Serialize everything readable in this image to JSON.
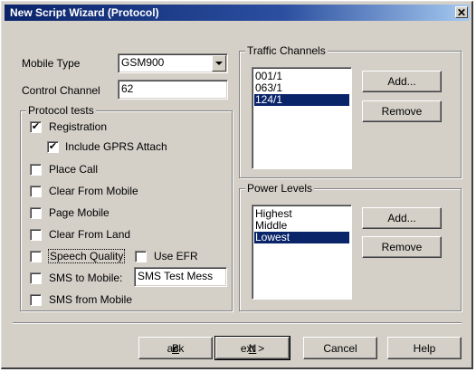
{
  "window": {
    "title": "New Script Wizard (Protocol)",
    "close_glyph": "✕"
  },
  "form": {
    "mobile_type_label": "Mobile Type",
    "mobile_type_value": "GSM900",
    "control_channel_label": "Control Channel",
    "control_channel_value": "62"
  },
  "protocol_tests": {
    "title": "Protocol tests",
    "registration": {
      "label": "Registration",
      "checked": true
    },
    "gprs_attach": {
      "label": "Include GPRS Attach",
      "checked": true
    },
    "place_call": {
      "label": "Place Call",
      "checked": false
    },
    "clear_from_mobile": {
      "label": "Clear From Mobile",
      "checked": false
    },
    "page_mobile": {
      "label": "Page Mobile",
      "checked": false
    },
    "clear_from_land": {
      "label": "Clear From Land",
      "checked": false
    },
    "speech_quality": {
      "label": "Speech Quality",
      "checked": false
    },
    "use_efr": {
      "label": "Use EFR",
      "checked": false
    },
    "sms_to_mobile": {
      "label": "SMS to Mobile:",
      "checked": false,
      "text_value": "SMS Test Mess"
    },
    "sms_from_mobile": {
      "label": "SMS from Mobile",
      "checked": false
    }
  },
  "traffic_channels": {
    "title": "Traffic Channels",
    "items": [
      "001/1",
      "063/1",
      "124/1"
    ],
    "selected_index": 2,
    "add_label": "Add...",
    "remove_label": "Remove"
  },
  "power_levels": {
    "title": "Power Levels",
    "items": [
      "Highest",
      "Middle",
      "Lowest"
    ],
    "selected_index": 2,
    "add_label": "Add...",
    "remove_label": "Remove"
  },
  "buttons": {
    "back_prefix": "< ",
    "back_mnemonic": "B",
    "back_rest": "ack",
    "next_mnemonic": "N",
    "next_rest": "ext >",
    "cancel": "Cancel",
    "help": "Help"
  },
  "colors": {
    "face": "#d4d0c8",
    "title_start": "#0a246a",
    "title_end": "#a6caf0",
    "selection": "#0a246a"
  }
}
